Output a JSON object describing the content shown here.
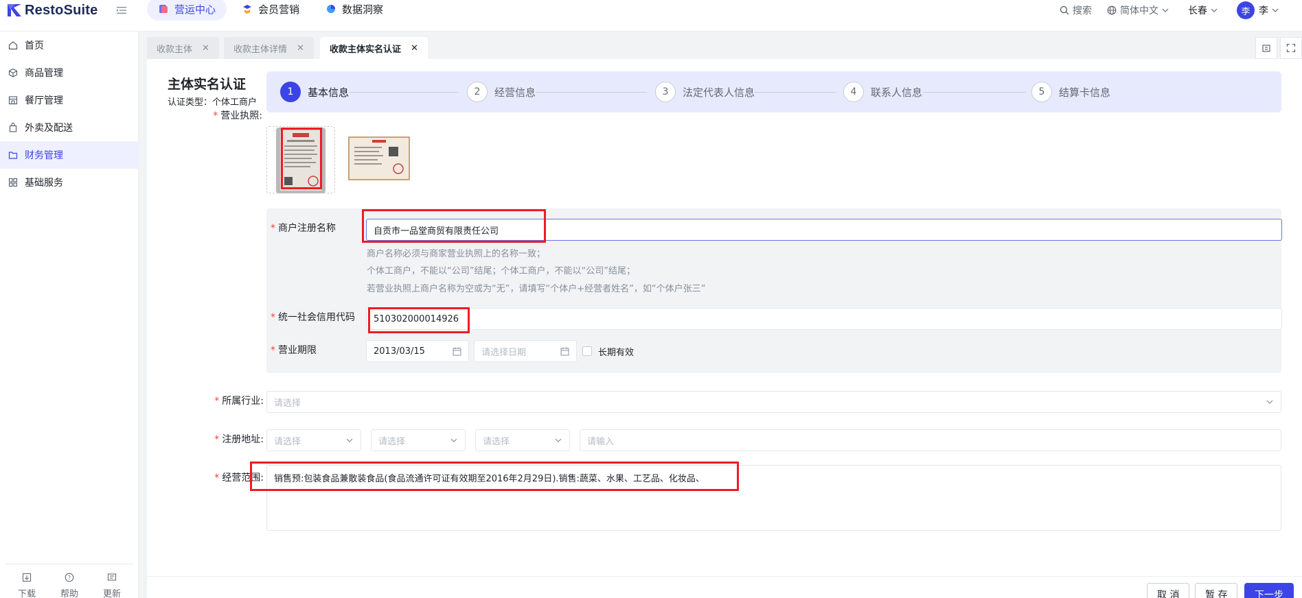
{
  "app": {
    "name": "RestoSuite"
  },
  "topnav": [
    {
      "label": "营运中心",
      "active": true
    },
    {
      "label": "会员营销",
      "active": false
    },
    {
      "label": "数据洞察",
      "active": false
    }
  ],
  "header": {
    "search_label": "搜索",
    "language_label": "简体中文",
    "city_label": "长春",
    "avatar_initial": "李",
    "user_name": "李"
  },
  "sidebar": {
    "items": [
      {
        "label": "首页",
        "icon": "home-icon"
      },
      {
        "label": "商品管理",
        "icon": "box-icon"
      },
      {
        "label": "餐厅管理",
        "icon": "store-icon"
      },
      {
        "label": "外卖及配送",
        "icon": "bag-icon"
      },
      {
        "label": "财务管理",
        "icon": "folder-icon",
        "active": true
      },
      {
        "label": "基础服务",
        "icon": "grid-icon"
      }
    ],
    "bottom": [
      {
        "label": "下载",
        "icon": "download-icon"
      },
      {
        "label": "帮助",
        "icon": "help-icon"
      },
      {
        "label": "更新",
        "icon": "update-icon"
      }
    ]
  },
  "tabs": [
    {
      "label": "收款主体",
      "active": false
    },
    {
      "label": "收款主体详情",
      "active": false
    },
    {
      "label": "收款主体实名认证",
      "active": true
    }
  ],
  "page": {
    "title": "主体实名认证",
    "cert_type": "认证类型：个体工商户"
  },
  "steps": [
    {
      "num": "1",
      "label": "基本信息",
      "active": true
    },
    {
      "num": "2",
      "label": "经营信息",
      "active": false
    },
    {
      "num": "3",
      "label": "法定代表人信息",
      "active": false
    },
    {
      "num": "4",
      "label": "联系人信息",
      "active": false
    },
    {
      "num": "5",
      "label": "结算卡信息",
      "active": false
    }
  ],
  "form": {
    "license_label": "营业执照:",
    "merchant_name_label": "商户注册名称",
    "merchant_name_value": "自贡市一品堂商贸有限责任公司",
    "hints": [
      "商户名称必须与商家营业执照上的名称一致；",
      "个体工商户，不能以“公司”结尾；个体工商户，不能以“公司”结尾；",
      "若营业执照上商户名称为空或为“无”，请填写“个体户+经营者姓名”，如“个体户张三”"
    ],
    "credit_code_label": "统一社会信用代码",
    "credit_code_value": "510302000014926",
    "period_label": "营业期限",
    "period_start": "2013/03/15",
    "period_end_placeholder": "请选择日期",
    "long_term_label": "长期有效",
    "industry_label": "所属行业:",
    "industry_placeholder": "请选择",
    "address_label": "注册地址:",
    "address_select_placeholder": "请选择",
    "address_input_placeholder": "请输入",
    "scope_label": "经营范围:",
    "scope_value": "销售预:包装食品兼散装食品(食品流通许可证有效期至2016年2月29日).销售:蔬菜、水果、工艺品、化妆品、"
  },
  "actions": {
    "cancel": "取 消",
    "save": "暂 存",
    "next": "下一步"
  },
  "colors": {
    "accent": "#3d44e6",
    "highlight_box": "#ee1c24",
    "required": "#f53f3f"
  }
}
